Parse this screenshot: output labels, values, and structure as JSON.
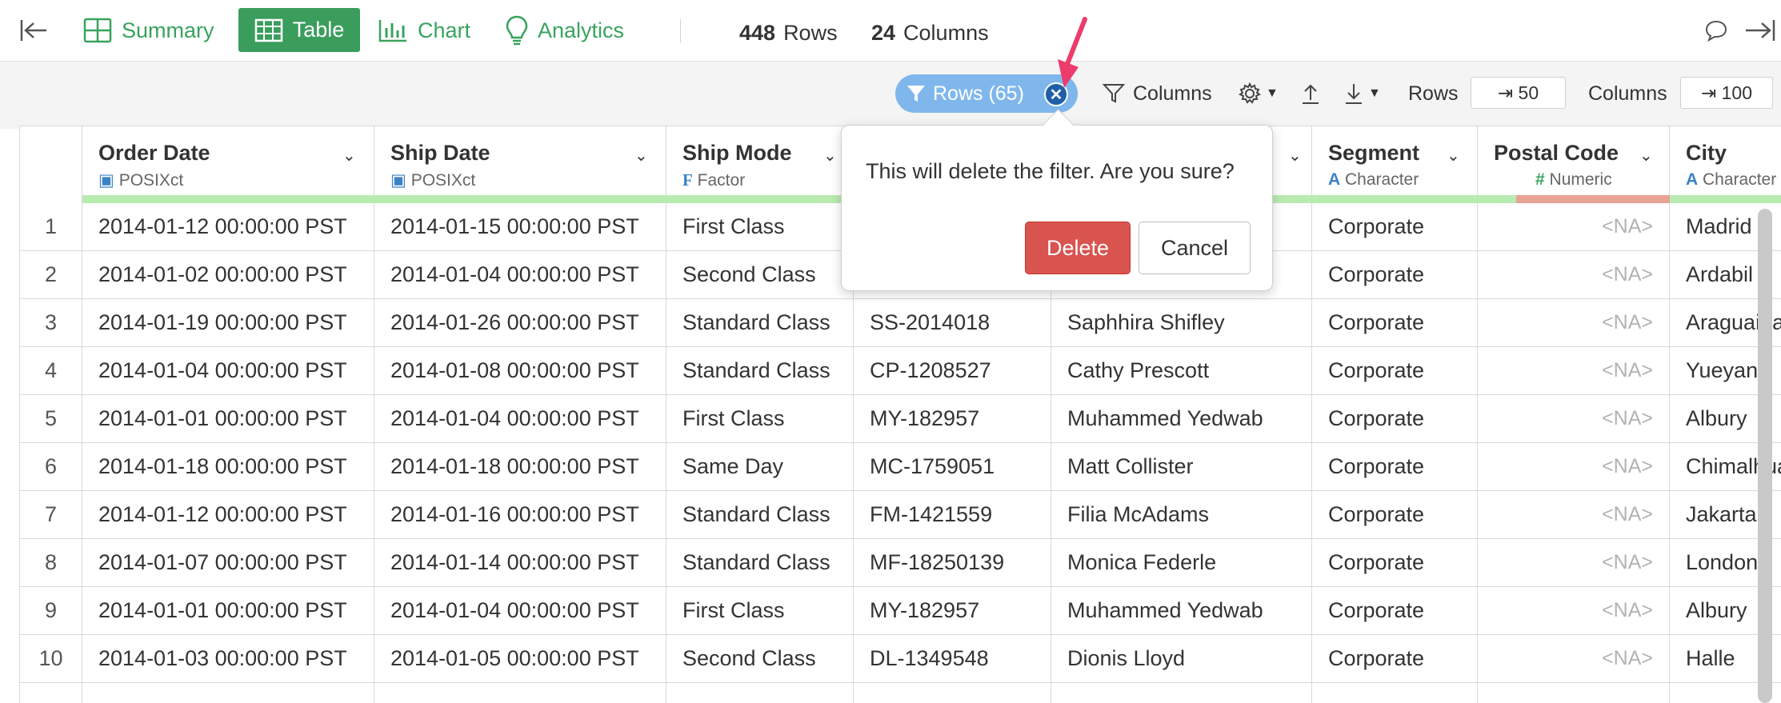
{
  "nav": {
    "summary": "Summary",
    "table": "Table",
    "chart": "Chart",
    "analytics": "Analytics",
    "rows_count": "448",
    "rows_label": "Rows",
    "cols_count": "24",
    "cols_label": "Columns"
  },
  "toolbar": {
    "filter_pill": "Rows (65)",
    "columns_label": "Columns",
    "rows_label": "Rows",
    "rows_value": "⇥ 50",
    "cols_label": "Columns",
    "cols_value": "⇥ 100"
  },
  "popover": {
    "message": "This will delete the filter. Are you sure?",
    "delete": "Delete",
    "cancel": "Cancel"
  },
  "columns": [
    {
      "name": "Order Date",
      "type": "POSIXct"
    },
    {
      "name": "Ship Date",
      "type": "POSIXct"
    },
    {
      "name": "Ship Mode",
      "type": "Factor"
    },
    {
      "name": "",
      "type": ""
    },
    {
      "name": "",
      "type": ""
    },
    {
      "name": "Segment",
      "type": "Character"
    },
    {
      "name": "Postal Code",
      "type": "Numeric"
    },
    {
      "name": "City",
      "type": "Character"
    }
  ],
  "rows": [
    {
      "n": "1",
      "order": "2014-01-12 00:00:00 PST",
      "ship": "2014-01-15 00:00:00 PST",
      "mode": "First Class",
      "cid": "",
      "cname": "",
      "seg": "Corporate",
      "postal": "<NA>",
      "city": "Madrid"
    },
    {
      "n": "2",
      "order": "2014-01-02 00:00:00 PST",
      "ship": "2014-01-04 00:00:00 PST",
      "mode": "Second Class",
      "cid": "",
      "cname": "",
      "seg": "Corporate",
      "postal": "<NA>",
      "city": "Ardabil"
    },
    {
      "n": "3",
      "order": "2014-01-19 00:00:00 PST",
      "ship": "2014-01-26 00:00:00 PST",
      "mode": "Standard Class",
      "cid": "SS-2014018",
      "cname": "Saphhira Shifley",
      "seg": "Corporate",
      "postal": "<NA>",
      "city": "Araguaina"
    },
    {
      "n": "4",
      "order": "2014-01-04 00:00:00 PST",
      "ship": "2014-01-08 00:00:00 PST",
      "mode": "Standard Class",
      "cid": "CP-1208527",
      "cname": "Cathy Prescott",
      "seg": "Corporate",
      "postal": "<NA>",
      "city": "Yueyang"
    },
    {
      "n": "5",
      "order": "2014-01-01 00:00:00 PST",
      "ship": "2014-01-04 00:00:00 PST",
      "mode": "First Class",
      "cid": "MY-182957",
      "cname": "Muhammed Yedwab",
      "seg": "Corporate",
      "postal": "<NA>",
      "city": "Albury"
    },
    {
      "n": "6",
      "order": "2014-01-18 00:00:00 PST",
      "ship": "2014-01-18 00:00:00 PST",
      "mode": "Same Day",
      "cid": "MC-1759051",
      "cname": "Matt Collister",
      "seg": "Corporate",
      "postal": "<NA>",
      "city": "Chimalhuacan"
    },
    {
      "n": "7",
      "order": "2014-01-12 00:00:00 PST",
      "ship": "2014-01-16 00:00:00 PST",
      "mode": "Standard Class",
      "cid": "FM-1421559",
      "cname": "Filia McAdams",
      "seg": "Corporate",
      "postal": "<NA>",
      "city": "Jakarta"
    },
    {
      "n": "8",
      "order": "2014-01-07 00:00:00 PST",
      "ship": "2014-01-14 00:00:00 PST",
      "mode": "Standard Class",
      "cid": "MF-18250139",
      "cname": "Monica Federle",
      "seg": "Corporate",
      "postal": "<NA>",
      "city": "London"
    },
    {
      "n": "9",
      "order": "2014-01-01 00:00:00 PST",
      "ship": "2014-01-04 00:00:00 PST",
      "mode": "First Class",
      "cid": "MY-182957",
      "cname": "Muhammed Yedwab",
      "seg": "Corporate",
      "postal": "<NA>",
      "city": "Albury"
    },
    {
      "n": "10",
      "order": "2014-01-03 00:00:00 PST",
      "ship": "2014-01-05 00:00:00 PST",
      "mode": "Second Class",
      "cid": "DL-1349548",
      "cname": "Dionis Lloyd",
      "seg": "Corporate",
      "postal": "<NA>",
      "city": "Halle"
    }
  ],
  "colors": {
    "accent_green": "#3a9d5c",
    "filter_pill": "#7fb7ec",
    "delete_red": "#d9534f",
    "quality_good": "#b8ebb0",
    "quality_bad": "#e9a394"
  }
}
